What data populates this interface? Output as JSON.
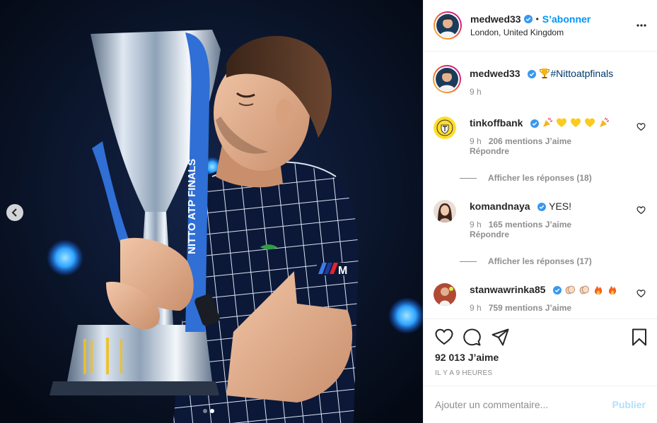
{
  "post": {
    "author": "medwed33",
    "follow_label": "S’abonner",
    "bullet": "•",
    "location": "London, United Kingdom",
    "caption": "#Nittoatpfinals",
    "caption_time": "9 h",
    "trophy_text": "NITTO ATP FINALS",
    "brand_text": "M"
  },
  "comments": [
    {
      "user": "tinkoffbank",
      "emojis": [
        "party-popper",
        "yellow-heart",
        "yellow-heart",
        "yellow-heart",
        "party-popper"
      ],
      "time": "9 h",
      "likes": "206 mentions J’aime",
      "reply": "Répondre",
      "view_replies": "Afficher les réponses (18)"
    },
    {
      "user": "komandnaya",
      "text": "YES!",
      "time": "9 h",
      "likes": "165 mentions J’aime",
      "reply": "Répondre",
      "view_replies": "Afficher les réponses (17)"
    },
    {
      "user": "stanwawrinka85",
      "emojis": [
        "clapping-hands",
        "clapping-hands",
        "fire",
        "fire"
      ],
      "time": "9 h",
      "likes": "759 mentions J’aime"
    }
  ],
  "actions": {
    "likes": "92 013 J’aime",
    "time_ago": "IL Y A 9 HEURES"
  },
  "composer": {
    "placeholder": "Ajouter un commentaire...",
    "publish_label": "Publier"
  },
  "colors": {
    "accent": "#0095f6",
    "publish_disabled": "#b2dffc",
    "trophy_ribbon": "#2f6fd6",
    "shirt": "#0c1838"
  },
  "icons": [
    "chevron-left-icon",
    "more-icon",
    "verified-icon",
    "heart-icon",
    "comment-icon",
    "share-icon",
    "bookmark-icon",
    "trophy-icon"
  ]
}
